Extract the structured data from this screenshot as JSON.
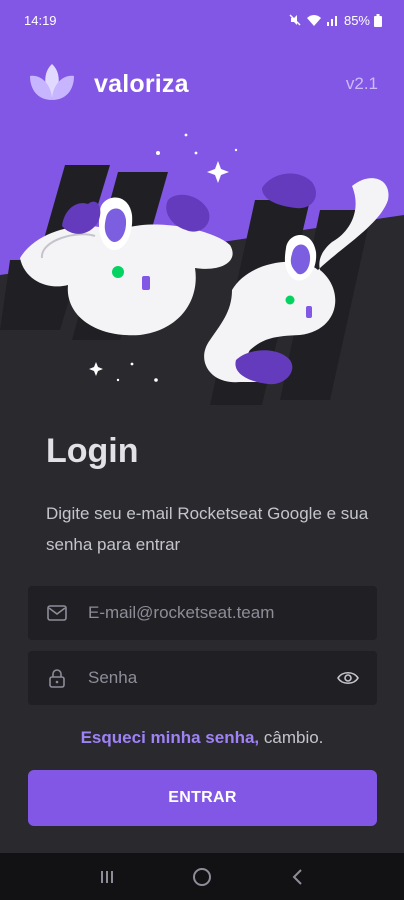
{
  "status_bar": {
    "time": "14:19",
    "battery": "85%"
  },
  "header": {
    "app_name": "valoriza",
    "version": "v2.1"
  },
  "login": {
    "title": "Login",
    "subtitle": "Digite seu e-mail Rocketseat Google e sua senha para entrar"
  },
  "form": {
    "email_placeholder": "E-mail@rocketseat.team",
    "password_placeholder": "Senha",
    "forgot_link": "Esqueci minha senha,",
    "forgot_suffix": " câmbio.",
    "submit_label": "ENTRAR"
  },
  "colors": {
    "brand": "#8257e5",
    "background": "#29292e",
    "input": "#202024",
    "link": "#9f82f5"
  },
  "icons": {
    "email": "mail-icon",
    "password": "lock-icon",
    "toggle": "eye-icon"
  }
}
